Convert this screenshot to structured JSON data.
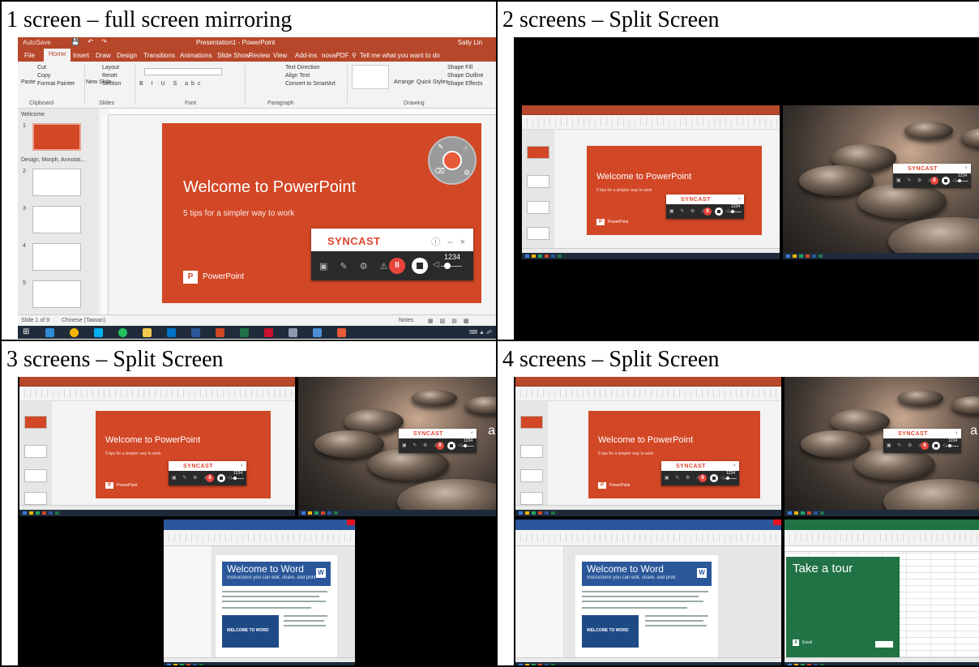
{
  "cells": {
    "one": "1 screen – full screen mirroring",
    "two": "2 screens – Split Screen",
    "three": "3 screens – Split Screen",
    "four": "4 screens – Split Screen"
  },
  "powerpoint": {
    "window_title": "Presentation1 - PowerPoint",
    "autosave": "AutoSave",
    "user": "Sally Lin",
    "tabs": [
      "File",
      "Home",
      "Insert",
      "Draw",
      "Design",
      "Transitions",
      "Animations",
      "Slide Show",
      "Review",
      "View",
      "Add-ins",
      "novaPDF"
    ],
    "tell_me": "Tell me what you want to do",
    "ribbon": {
      "cut": "Cut",
      "copy": "Copy",
      "paste": "Paste",
      "format_painter": "Format Painter",
      "layout": "Layout",
      "reset": "Reset",
      "new_slide": "New Slide",
      "section": "Section",
      "text_direction": "Text Direction",
      "align_text": "Align Text",
      "convert_smartart": "Convert to SmartArt",
      "arrange": "Arrange",
      "quick_styles": "Quick Styles",
      "shape_fill": "Shape Fill",
      "shape_outline": "Shape Outline",
      "shape_effects": "Shape Effects",
      "groups": [
        "Clipboard",
        "Slides",
        "Font",
        "Paragraph",
        "Drawing"
      ]
    },
    "sections": [
      "Welcome",
      "Design, Morph, Annotat..."
    ],
    "slide_numbers": [
      "1",
      "2",
      "3",
      "4",
      "5"
    ],
    "slide": {
      "title": "Welcome to PowerPoint",
      "subtitle": "5 tips for a simpler way to work",
      "logo_letter": "P",
      "logo_text": "PowerPoint"
    },
    "status": {
      "slide_of": "Slide 1 of 9",
      "language": "Chinese (Taiwan)",
      "notes": "Notes"
    }
  },
  "syncast": {
    "brand": "SYNCAST",
    "info_icon": "ⓘ",
    "minimize": "–",
    "close": "×",
    "tools": "▣ ✎ ⚙ ⚠",
    "pause": "II",
    "volume_icon": "◁",
    "count": "1234",
    "volume_level": 0.1
  },
  "word": {
    "title": "Welcome to Word",
    "subtitle": "Instructions you can edit, share, and print",
    "logo_letter": "W",
    "video_text": "WELCOME TO WORD"
  },
  "excel": {
    "title": "Take a tour",
    "logo_letter": "X",
    "logo_text": "Excel"
  },
  "edge_letter": "a",
  "colors": {
    "powerpoint": "#d24726",
    "word": "#2b579a",
    "excel": "#217346",
    "syncast_red": "#e0452b",
    "taskbar": "#1f2b3a"
  }
}
